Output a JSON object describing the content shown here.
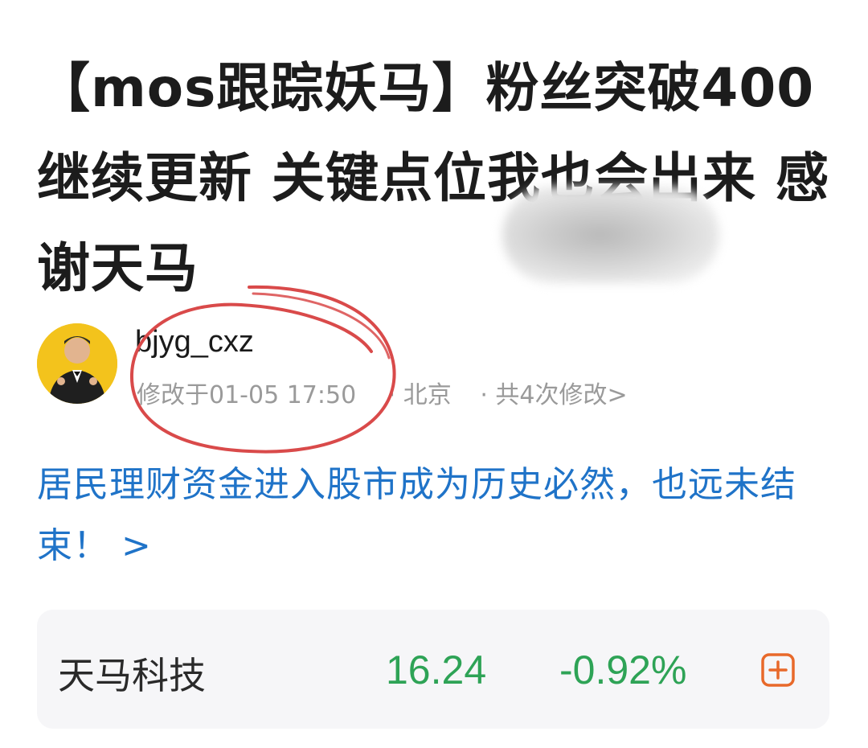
{
  "post": {
    "title": "【mos跟踪妖马】粉丝突破400继续更新 关键点位我也会出来 感谢天马"
  },
  "author": {
    "name": "bjyg_cxz",
    "modified": "修改于01-05 17:50",
    "location": "· 北京",
    "edit_count": "· 共4次修改>"
  },
  "topic": {
    "text": "居民理财资金进入股市成为历史必然，也远未结束！ >"
  },
  "stock": {
    "name": "天马科技",
    "price": "16.24",
    "change": "-0.92%",
    "change_color": "#2ea356",
    "add_icon": "plus-square-icon",
    "add_color": "#e8692a"
  },
  "annotation_color": "#d94a4a",
  "avatar_icon": "person-avatar-icon"
}
